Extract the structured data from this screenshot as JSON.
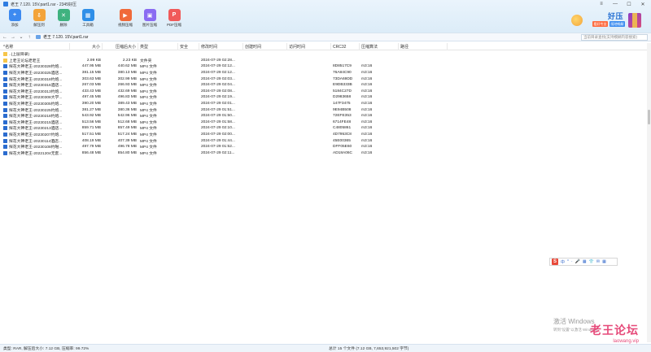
{
  "window": {
    "title": "老王 7.120. 15V.part1.rar - 2345好压"
  },
  "toolbar": {
    "buttons": [
      {
        "label": "添加",
        "icon": "add-archive-icon",
        "color": "#3d8af0"
      },
      {
        "label": "解压到",
        "icon": "extract-icon",
        "color": "#f3a43a"
      },
      {
        "label": "删除",
        "icon": "delete-icon",
        "color": "#3fb27f"
      },
      {
        "label": "工具箱",
        "icon": "toolbox-icon",
        "color": "#2f8fe8"
      },
      {
        "label": "视频压缩",
        "icon": "video-compress-icon",
        "color": "#f06a3a"
      },
      {
        "label": "图片压缩",
        "icon": "image-compress-icon",
        "color": "#8a6cf2"
      },
      {
        "label": "PDF压缩",
        "icon": "pdf-compress-icon",
        "color": "#f05a5a"
      }
    ]
  },
  "promo": {
    "title": "好压",
    "chip1": "看好专业",
    "chip2": "随地畅解"
  },
  "addressbar": {
    "path": "老王 7.120. 15V.part1.rar",
    "search_placeholder": "当前目录查找(支持模糊内容搜索)"
  },
  "columns": [
    "名称",
    "大小",
    "压缩后大小",
    "类型",
    "安全",
    "修改时间",
    "创建时间",
    "访问时间",
    "CRC32",
    "压缩算法",
    "路径"
  ],
  "rows": [
    {
      "name": "..(上层目录)",
      "size": "",
      "packed": "",
      "type": "",
      "modified": "",
      "crc": "",
      "method": "",
      "icon": "folder"
    },
    {
      "name": "上老王论坛老老王",
      "size": "2.99 KB",
      "packed": "2.23 KB",
      "type": "文件夹",
      "modified": "2024-07-29 02:28...",
      "crc": "",
      "method": "",
      "icon": "folder"
    },
    {
      "name": "探花大神老王-20230328约炮...",
      "size": "447.95 MB",
      "packed": "440.62 MB",
      "type": "MP4 文件",
      "modified": "2024-07-29 02:12...",
      "crc": "8D8517C9",
      "method": "m3:16",
      "icon": "video"
    },
    {
      "name": "探花大神老王-20230325酒店...",
      "size": "381.15 MB",
      "packed": "380.13 MB",
      "type": "MP4 文件",
      "modified": "2024-07-29 02:12...",
      "crc": "76A84C90",
      "method": "m3:16",
      "icon": "video"
    },
    {
      "name": "探花大神老王-20230318约炮...",
      "size": "303.63 MB",
      "packed": "302.99 MB",
      "type": "MP4 文件",
      "modified": "2024-07-29 02:03...",
      "crc": "73DA69DD",
      "method": "m3:16",
      "icon": "video"
    },
    {
      "name": "探花大神老王-20230316酒店...",
      "size": "267.03 MB",
      "packed": "266.93 MB",
      "type": "MP4 文件",
      "modified": "2024-07-29 02:04...",
      "crc": "E9DB333B",
      "method": "m3:16",
      "icon": "video"
    },
    {
      "name": "探花大神老王-20230313约炮...",
      "size": "433.43 MB",
      "packed": "432.69 MB",
      "type": "MP4 文件",
      "modified": "2024-07-29 02:08...",
      "crc": "5184C27D",
      "method": "m3:16",
      "icon": "video"
    },
    {
      "name": "探花大神老王-20230308大学...",
      "size": "497.45 MB",
      "packed": "496.83 MB",
      "type": "MP4 文件",
      "modified": "2024-07-29 02:19...",
      "crc": "D2983658",
      "method": "m3:16",
      "icon": "video"
    },
    {
      "name": "探花大神老王-20230305约炮...",
      "size": "390.20 MB",
      "packed": "389.43 MB",
      "type": "MP4 文件",
      "modified": "2024-07-29 02:01...",
      "crc": "147F3475",
      "method": "m3:16",
      "icon": "video"
    },
    {
      "name": "探花大神老王-20230225约炮...",
      "size": "381.27 MB",
      "packed": "380.36 MB",
      "type": "MP4 文件",
      "modified": "2024-07-29 01:51...",
      "crc": "9E94B508",
      "method": "m3:16",
      "icon": "video"
    },
    {
      "name": "探花大神老王-20230218约炮...",
      "size": "543.92 MB",
      "packed": "542.96 MB",
      "type": "MP4 文件",
      "modified": "2024-07-29 01:50...",
      "crc": "72EFE353",
      "method": "m3:16",
      "icon": "video"
    },
    {
      "name": "探花大神老王-20230215酒店...",
      "size": "513.56 MB",
      "packed": "512.68 MB",
      "type": "MP4 文件",
      "modified": "2024-07-29 01:58...",
      "crc": "6714FE48",
      "method": "m3:16",
      "icon": "video"
    },
    {
      "name": "探花大神老王-20230213酒店...",
      "size": "859.71 MB",
      "packed": "857.49 MB",
      "type": "MP4 文件",
      "modified": "2024-07-29 02:10...",
      "crc": "C4805861",
      "method": "m3:16",
      "icon": "video"
    },
    {
      "name": "探花大神老王-20230207约炮...",
      "size": "517.51 MB",
      "packed": "517.24 MB",
      "type": "MP4 文件",
      "modified": "2024-07-29 02:00...",
      "crc": "4D7953C8",
      "method": "m3:16",
      "icon": "video"
    },
    {
      "name": "探花大神老王-20230114酒店...",
      "size": "408.19 MB",
      "packed": "407.39 MB",
      "type": "MP4 文件",
      "modified": "2024-07-29 01:44...",
      "crc": "45E00365",
      "method": "m3:16",
      "icon": "video"
    },
    {
      "name": "探花大神老王-20230108约啪...",
      "size": "497.79 MB",
      "packed": "496.78 MB",
      "type": "MP4 文件",
      "modified": "2024-07-29 01:52...",
      "crc": "DFF05E60",
      "method": "m3:16",
      "icon": "video"
    },
    {
      "name": "探花大神老王-20221204无套...",
      "size": "856.48 MB",
      "packed": "854.80 MB",
      "type": "MP4 文件",
      "modified": "2024-07-29 02:11...",
      "crc": "AD18A06C",
      "method": "m3:16",
      "icon": "video"
    }
  ],
  "ime": {
    "logo": "S",
    "items": [
      "中",
      "°",
      "·",
      "🎤",
      "▦",
      "👕",
      "✉",
      "▦"
    ]
  },
  "activation": {
    "line1": "激活 Windows",
    "line2": "转到\"设置\"以激活 Windows。"
  },
  "watermark": {
    "title": "老王论坛",
    "url": "laowang.vip"
  },
  "status": {
    "left": "类型: RAR, 解压后大小: 7.12 GB, 压缩率: 99.72%",
    "right": "总计 15 个文件 (7.12 GB, 7,653,921,502 字节)"
  }
}
